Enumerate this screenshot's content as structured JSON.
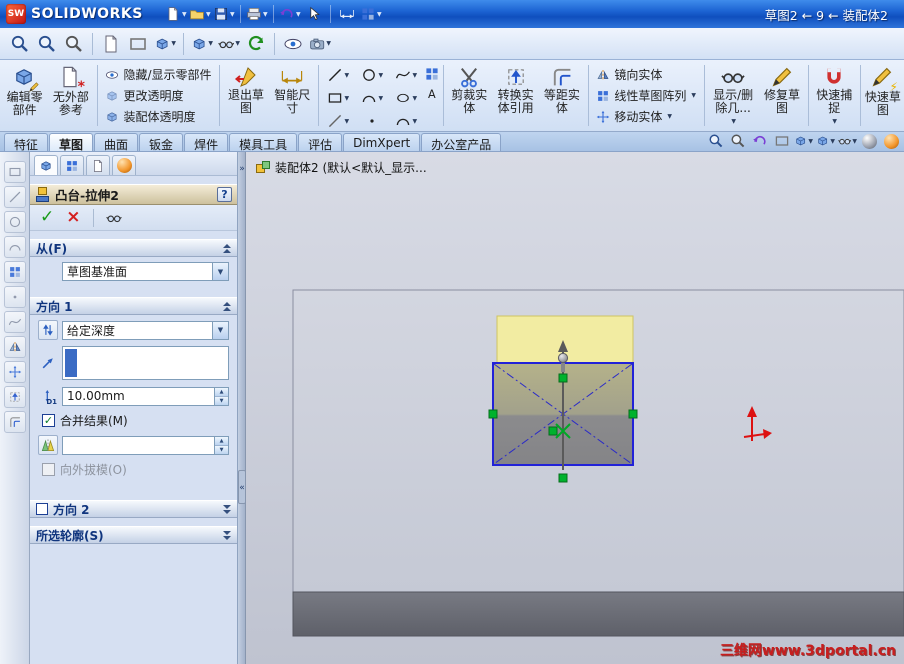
{
  "titlebar": {
    "app_name": "SOLIDWORKS",
    "doc_breadcrumb": "草图2 ← 9 ← 装配体2"
  },
  "command_tabs": {
    "items": [
      "特征",
      "草图",
      "曲面",
      "钣金",
      "焊件",
      "模具工具",
      "评估",
      "DimXpert",
      "办公室产品"
    ],
    "active": "草图"
  },
  "command_manager": {
    "buttons": {
      "edit_component": "编辑零部件",
      "no_external_ref": "无外部参考",
      "hide_show_components": "隐藏/显示零部件",
      "change_transparency": "更改透明度",
      "assembly_transparency": "装配体透明度",
      "exit_sketch": "退出草图",
      "smart_dimension": "智能尺寸",
      "trim_entities": "剪裁实体",
      "convert_entities": "转换实体引用",
      "offset_entities": "等距实体",
      "mirror_entities": "镜向实体",
      "linear_sketch_pattern": "线性草图阵列",
      "move_entities": "移动实体",
      "display_delete_relations": "显示/删除几...",
      "repair_sketch": "修复草图",
      "quick_snaps": "快速捕捉",
      "rapid_sketch": "快速草图"
    }
  },
  "property_manager": {
    "title": "凸台-拉伸2",
    "help": "?",
    "sections": {
      "from": {
        "label": "从(F)",
        "value": "草图基准面"
      },
      "direction1": {
        "label": "方向 1",
        "end_condition": "给定深度",
        "depth_value": "10.00mm",
        "depth_icon_label": "D1",
        "merge_result": "合并结果(M)",
        "merge_checked": true,
        "check_glyph": "✓",
        "draft_outward": "向外拔模(O)",
        "draft_outward_enabled": false
      },
      "direction2": {
        "label": "方向 2"
      },
      "selected_contours": {
        "label": "所选轮廓(S)"
      }
    }
  },
  "viewport": {
    "feature_tree_label": "装配体2 (默认<默认_显示...",
    "watermark": "三维网www.3dportal.cn"
  },
  "icons": {
    "solidworks-logo": "red cube with SW letters",
    "new-document-icon": "white page",
    "open-icon": "yellow folder",
    "save-icon": "blue floppy disk",
    "print-icon": "printer",
    "undo-icon": "purple curved arrow",
    "select-cursor-icon": "white arrow cursor",
    "zoom-icon": "magnifier",
    "view-orientation-icon": "blue cube",
    "display-style-icon": "shaded cube",
    "hide-show-items-icon": "eyeglasses",
    "redraw-icon": "green circular arrow",
    "ok-icon": "green check",
    "cancel-icon": "red cross",
    "detailed-preview-icon": "eyeglasses",
    "reverse-direction-icon": "blue up-down arrows",
    "direction-reference-icon": "blue north-east arrow",
    "depth-icon": "vertical double arrow with D1",
    "draft-icon": "green-yellow draft triangle",
    "relation-marker": "green square",
    "origin-triad": "red arrows"
  },
  "colors": {
    "titlebar_blue": "#1157c8",
    "toolbar_blue": "#d7e4f7",
    "selection_blue": "#3a6bc4",
    "sketch_line_blue": "#2222d8",
    "preview_yellow": "#f4ee9c",
    "relation_green": "#00b22d",
    "triad_red": "#dd1111",
    "plate_gray": "#ccd0da",
    "plate_side_gray": "#6b6d75",
    "pm_header_tan": "#d5cba6"
  }
}
